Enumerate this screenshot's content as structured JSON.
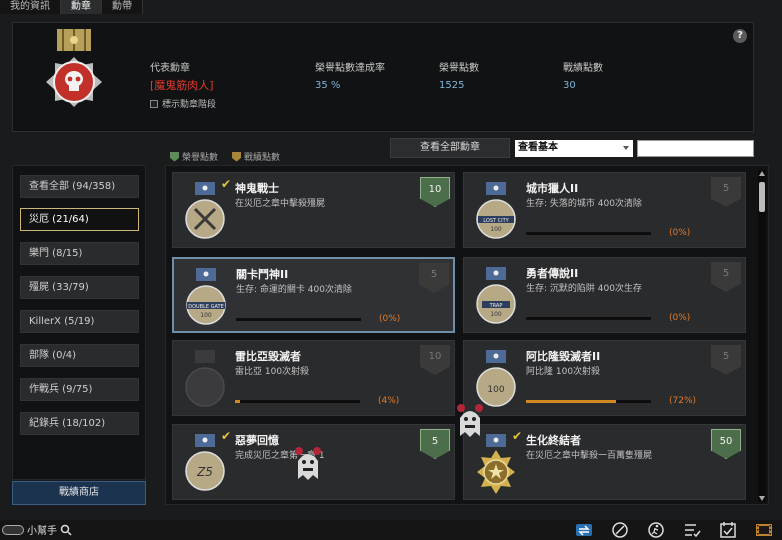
{
  "tabs": [
    "我的資訊",
    "勳章",
    "勳帶"
  ],
  "active_tab": 1,
  "header": {
    "rep_medal_label": "代表勳章",
    "rep_medal_name": "[魔鬼筋肉人]",
    "show_stage_label": "標示勳章階段",
    "honor_rate_label": "榮譽點數達成率",
    "honor_rate_value": "35 %",
    "honor_points_label": "榮譽點數",
    "honor_points_value": "1525",
    "battle_points_label": "戰績點數",
    "battle_points_value": "30",
    "help": "?"
  },
  "legend": {
    "honor": "榮譽點數",
    "battle": "戰績點數"
  },
  "controls": {
    "view_all": "查看全部勳章",
    "filter_selected": "查看基本"
  },
  "sidebar": {
    "items": [
      {
        "label": "查看全部 (94/358)"
      },
      {
        "label": "災厄 (21/64)"
      },
      {
        "label": "樂門 (8/15)"
      },
      {
        "label": "殭屍 (33/79)"
      },
      {
        "label": "KillerX (5/19)"
      },
      {
        "label": "部隊 (0/4)"
      },
      {
        "label": "作戰兵 (9/75)"
      },
      {
        "label": "紀錄兵 (18/102)"
      }
    ],
    "active_index": 1,
    "shop_button": "戰績商店"
  },
  "cards": [
    {
      "title": "神鬼戰士",
      "desc": "在災厄之章中擊殺殭屍",
      "points": "10",
      "pts_style": "green",
      "done": true,
      "progress": null,
      "pct": "",
      "emblem": "crossed-swords"
    },
    {
      "title": "城市獵人II",
      "desc": "生存: 失落的城市 400次清除",
      "points": "5",
      "pts_style": "gray",
      "done": false,
      "progress": 0,
      "pct": "(0%)",
      "emblem": "LOST CITY 100"
    },
    {
      "title": "關卡鬥神II",
      "desc": "生存: 命運的關卡 400次清除",
      "points": "5",
      "pts_style": "gray",
      "done": false,
      "progress": 0,
      "pct": "(0%)",
      "emblem": "DOUBLE GATE 100",
      "selected": true
    },
    {
      "title": "勇者傳說II",
      "desc": "生存: 沉默的陷阱 400次生存",
      "points": "5",
      "pts_style": "gray",
      "done": false,
      "progress": 0,
      "pct": "(0%)",
      "emblem": "TRAP 100"
    },
    {
      "title": "雷比亞毀滅者",
      "desc": "雷比亞 100次射殺",
      "points": "10",
      "pts_style": "gray",
      "done": false,
      "progress": 0.04,
      "pct": "(4%)",
      "emblem": "rebia"
    },
    {
      "title": "阿比隆毀滅者II",
      "desc": "阿比隆 100次射殺",
      "points": "5",
      "pts_style": "gray",
      "done": false,
      "progress": 0.72,
      "pct": "(72%)",
      "emblem": "100"
    },
    {
      "title": "惡夢回憶",
      "desc": "完成災厄之章第一章 1",
      "points": "5",
      "pts_style": "green",
      "done": true,
      "progress": null,
      "pct": "",
      "emblem": "Z5"
    },
    {
      "title": "生化終結者",
      "desc": "在災厄之章中擊殺一百萬隻殭屍",
      "points": "50",
      "pts_style": "green",
      "done": true,
      "progress": null,
      "pct": "",
      "emblem": "gold-star"
    }
  ],
  "footer": {
    "helper_label": "小幫手"
  },
  "colors": {
    "accent_orange": "#d08a1f",
    "rep_name_red": "#e23b2b",
    "value_blue": "#7fb3d5"
  }
}
